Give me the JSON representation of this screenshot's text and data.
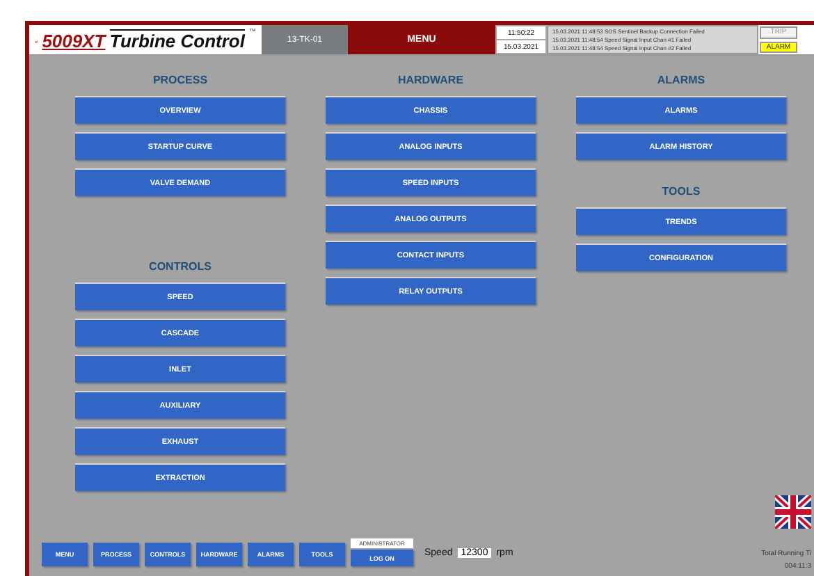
{
  "header": {
    "logo_number": "5009XT",
    "logo_title": "Turbine Control",
    "logo_tm": "™",
    "unit": "13-TK-01",
    "menu": "MENU",
    "time": "11:50:22",
    "date": "15.03.2021",
    "alarms": [
      "15.03.2021 11:48:53 SOS Sentinel Backup Connection Failed",
      "15.03.2021 11:48:54 Speed Signal Input Chan #1 Failed",
      "15.03.2021 11:48:54 Speed Signal Input Chan #2 Failed"
    ],
    "indicators": [
      {
        "label": "TRIP",
        "on": false
      },
      {
        "label": "ALARM",
        "on": true
      }
    ]
  },
  "columns": [
    {
      "sections": [
        {
          "title": "PROCESS",
          "buttons": [
            "OVERVIEW",
            "STARTUP CURVE",
            "VALVE DEMAND"
          ]
        },
        {
          "title": "CONTROLS",
          "buttons": [
            "SPEED",
            "CASCADE",
            "INLET",
            "AUXILIARY",
            "EXHAUST",
            "EXTRACTION"
          ]
        }
      ]
    },
    {
      "sections": [
        {
          "title": "HARDWARE",
          "buttons": [
            "CHASSIS",
            "ANALOG INPUTS",
            "SPEED INPUTS",
            "ANALOG OUTPUTS",
            "CONTACT INPUTS",
            "RELAY OUTPUTS"
          ]
        }
      ]
    },
    {
      "sections": [
        {
          "title": "ALARMS",
          "buttons": [
            "ALARMS",
            "ALARM HISTORY"
          ]
        },
        {
          "title": "TOOLS",
          "buttons": [
            "TRENDS",
            "CONFIGURATION"
          ]
        }
      ]
    }
  ],
  "nav": [
    "MENU",
    "PROCESS",
    "CONTROLS",
    "HARDWARE",
    "ALARMS",
    "TOOLS"
  ],
  "user": {
    "role": "ADMINISTRATOR",
    "button": "LOG ON"
  },
  "speed": {
    "label": "Speed",
    "value": "12300",
    "unit": "rpm"
  },
  "running": {
    "label": "Total Running Ti",
    "value": "004:11:3"
  }
}
